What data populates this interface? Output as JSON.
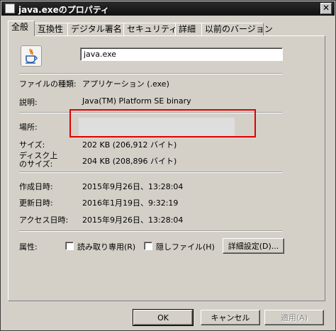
{
  "window": {
    "title": "java.exeのプロパティ"
  },
  "tabs": [
    {
      "label": "全般",
      "active": true
    },
    {
      "label": "互換性"
    },
    {
      "label": "デジタル署名"
    },
    {
      "label": "セキュリティ"
    },
    {
      "label": "詳細"
    },
    {
      "label": "以前のバージョン"
    }
  ],
  "general": {
    "file_name": "java.exe",
    "fields": {
      "type": {
        "label": "ファイルの種類:",
        "value": "アプリケーション (.exe)"
      },
      "desc": {
        "label": "説明:",
        "value": "Java(TM) Platform SE binary"
      },
      "location": {
        "label": "場所:",
        "value": ""
      },
      "size": {
        "label": "サイズ:",
        "value": "202 KB (206,912 バイト)"
      },
      "disk_size": {
        "label_line1": "ディスク上",
        "label_line2": "のサイズ:",
        "value": "204 KB (208,896 バイト)"
      },
      "created": {
        "label": "作成日時:",
        "value": "2015年9月26日、13:28:04"
      },
      "modified": {
        "label": "更新日時:",
        "value": "2016年1月19日、9:32:19"
      },
      "accessed": {
        "label": "アクセス日時:",
        "value": "2015年9月26日、13:28:04"
      }
    },
    "attributes": {
      "label": "属性:",
      "readonly": "読み取り専用(R)",
      "hidden": "隠しファイル(H)",
      "advanced": "詳細設定(D)..."
    }
  },
  "buttons": {
    "ok": "OK",
    "cancel": "キャンセル",
    "apply": "適用(A)"
  },
  "colors": {
    "highlight_box": "#e00000"
  }
}
